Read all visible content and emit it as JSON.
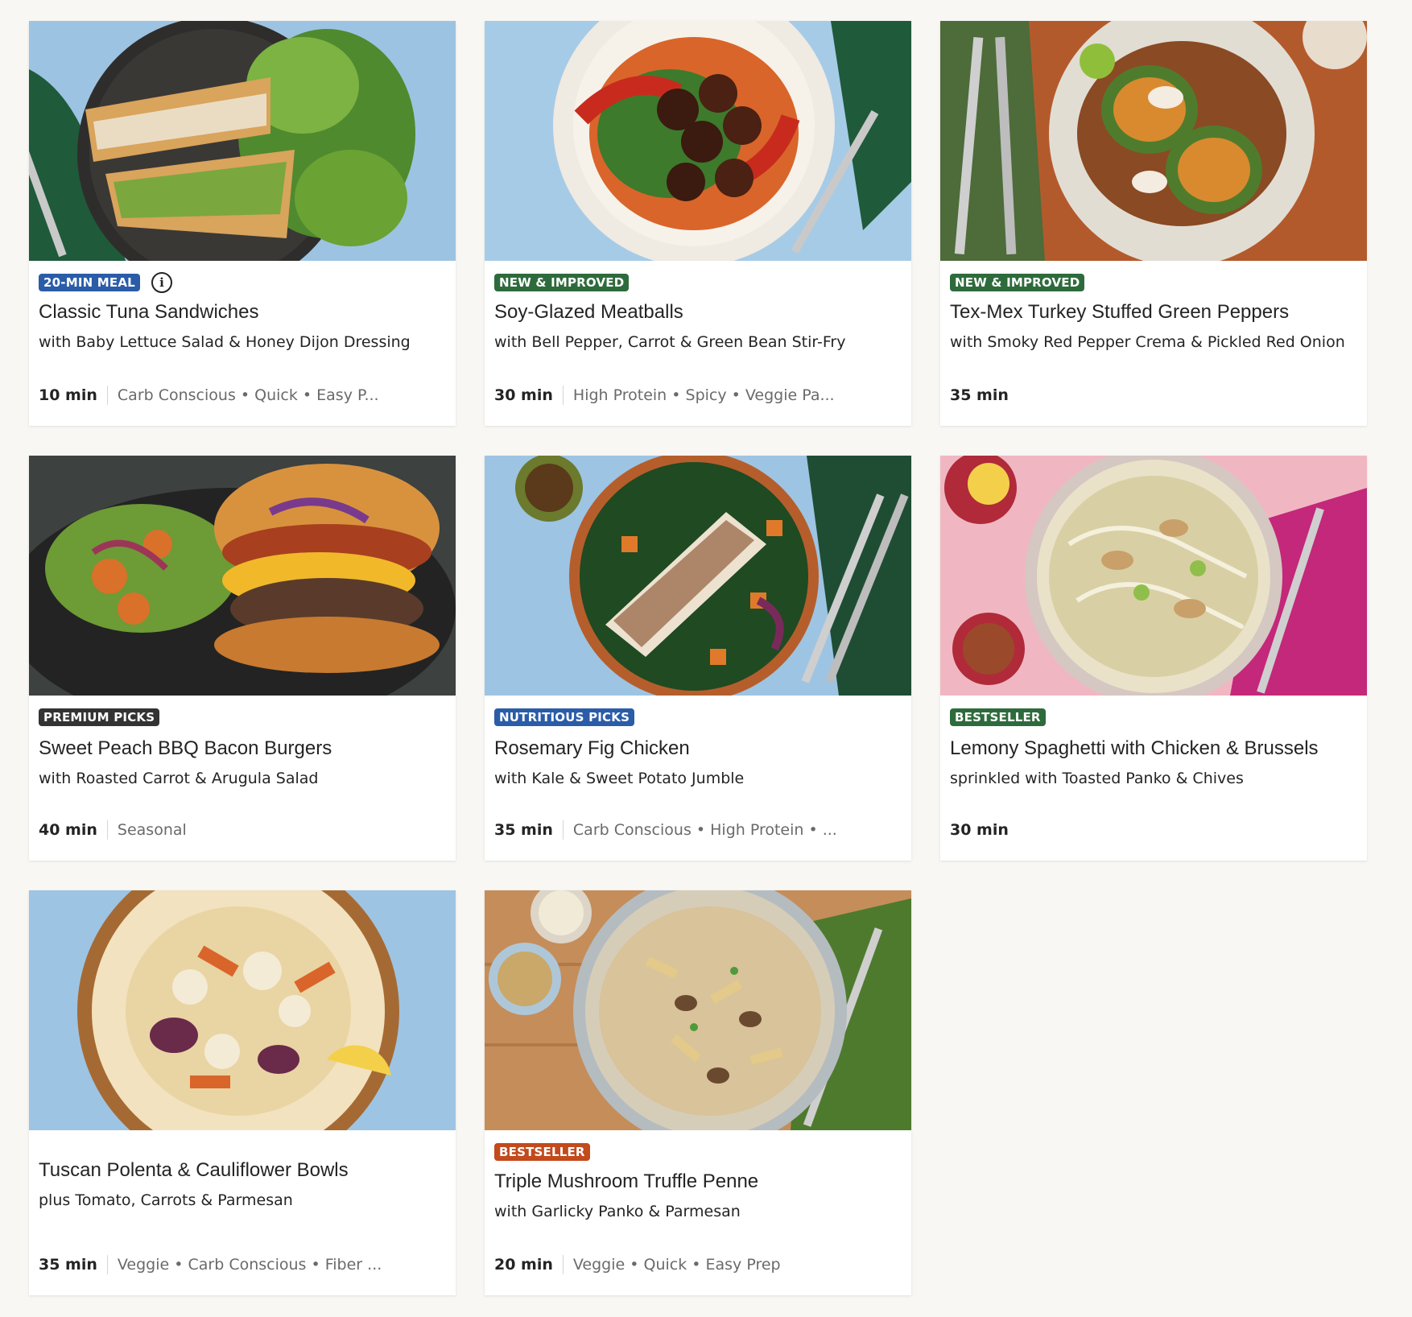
{
  "colors": {
    "badge_blue": "#2a5ca8",
    "badge_green": "#2e6b3c",
    "badge_dark": "#333333",
    "badge_orange": "#c24a1c"
  },
  "recipes": [
    {
      "badge": "20-MIN MEAL",
      "badge_color": "badge_blue",
      "has_info_icon": true,
      "title": "Classic Tuna Sandwiches",
      "subtitle": "with Baby Lettuce Salad & Honey Dijon Dressing",
      "time": "10 min",
      "tags": "Carb Conscious • Quick • Easy P..."
    },
    {
      "badge": "NEW & IMPROVED",
      "badge_color": "badge_green",
      "title": "Soy-Glazed Meatballs",
      "subtitle": "with Bell Pepper, Carrot & Green Bean Stir-Fry",
      "time": "30 min",
      "tags": "High Protein • Spicy • Veggie Pa..."
    },
    {
      "badge": "NEW & IMPROVED",
      "badge_color": "badge_green",
      "title": "Tex-Mex Turkey Stuffed Green Peppers",
      "subtitle": "with Smoky Red Pepper Crema & Pickled Red Onion",
      "time": "35 min",
      "tags": ""
    },
    {
      "badge": "PREMIUM PICKS",
      "badge_color": "badge_dark",
      "title": "Sweet Peach BBQ Bacon Burgers",
      "subtitle": "with Roasted Carrot & Arugula Salad",
      "time": "40 min",
      "tags": "Seasonal"
    },
    {
      "badge": "NUTRITIOUS PICKS",
      "badge_color": "badge_blue",
      "title": "Rosemary Fig Chicken",
      "subtitle": "with Kale & Sweet Potato Jumble",
      "time": "35 min",
      "tags": "Carb Conscious • High Protein • ..."
    },
    {
      "badge": "BESTSELLER",
      "badge_color": "badge_green",
      "title": "Lemony Spaghetti with Chicken & Brussels",
      "subtitle": "sprinkled with Toasted Panko & Chives",
      "time": "30 min",
      "tags": ""
    },
    {
      "badge": "",
      "badge_color": "",
      "title": "Tuscan Polenta & Cauliflower Bowls",
      "subtitle": "plus Tomato, Carrots & Parmesan",
      "time": "35 min",
      "tags": "Veggie • Carb Conscious • Fiber ..."
    },
    {
      "badge": "BESTSELLER",
      "badge_color": "badge_orange",
      "title": "Triple Mushroom Truffle Penne",
      "subtitle": "with Garlicky Panko & Parmesan",
      "time": "20 min",
      "tags": "Veggie • Quick • Easy Prep"
    }
  ]
}
